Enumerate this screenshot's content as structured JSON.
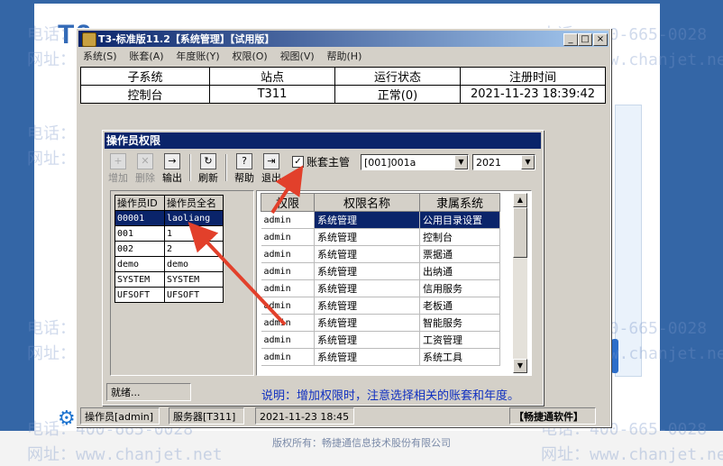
{
  "background": {
    "watermark_phone": "电话：400-665-0028",
    "watermark_site": "网址：www.chanjet.net",
    "footer": "版权所有：畅捷通信息技术股份有限公司",
    "logo_fragment": "T3 ",
    "left_tab_label": "账"
  },
  "window": {
    "title": "T3-标准版11.2【系统管理】【试用版】",
    "menu": [
      "系统(S)",
      "账套(A)",
      "年度账(Y)",
      "权限(O)",
      "视图(V)",
      "帮助(H)"
    ],
    "grid_headers": [
      "子系统",
      "站点",
      "运行状态",
      "注册时间"
    ],
    "grid_row": [
      "控制台",
      "T311",
      "正常(0)",
      "2021-11-23 18:39:42"
    ],
    "status": {
      "operator": "操作员[admin]",
      "server": "服务器[T311]",
      "datetime": "2021-11-23 18:45",
      "brand": "【畅捷通软件】"
    }
  },
  "dialog": {
    "title": "操作员权限",
    "toolbar": [
      {
        "label": "增加",
        "icon": "add-icon",
        "enabled": false
      },
      {
        "label": "删除",
        "icon": "delete-icon",
        "enabled": false
      },
      {
        "label": "输出",
        "icon": "export-icon",
        "enabled": true
      },
      {
        "label": "刷新",
        "icon": "refresh-icon",
        "enabled": true
      },
      {
        "label": "帮助",
        "icon": "help-icon",
        "enabled": true
      },
      {
        "label": "退出",
        "icon": "exit-icon",
        "enabled": true
      }
    ],
    "account_manager_label": "账套主管",
    "account_manager_checked": true,
    "account_select": "[001]001a",
    "year_select": "2021",
    "operator_headers": [
      "操作员ID",
      "操作员全名"
    ],
    "operators": [
      {
        "id": "00001",
        "name": "laoliang",
        "selected": true
      },
      {
        "id": "001",
        "name": "1",
        "selected": false
      },
      {
        "id": "002",
        "name": "2",
        "selected": false
      },
      {
        "id": "demo",
        "name": "demo",
        "selected": false
      },
      {
        "id": "SYSTEM",
        "name": "SYSTEM",
        "selected": false
      },
      {
        "id": "UFSOFT",
        "name": "UFSOFT",
        "selected": false
      }
    ],
    "permission_headers": [
      "权限",
      "权限名称",
      "隶属系统"
    ],
    "permissions": [
      {
        "perm": "admin",
        "name": "系统管理",
        "system": "公用目录设置"
      },
      {
        "perm": "admin",
        "name": "系统管理",
        "system": "控制台"
      },
      {
        "perm": "admin",
        "name": "系统管理",
        "system": "票据通"
      },
      {
        "perm": "admin",
        "name": "系统管理",
        "system": "出纳通"
      },
      {
        "perm": "admin",
        "name": "系统管理",
        "system": "信用服务"
      },
      {
        "perm": "admin",
        "name": "系统管理",
        "system": "老板通"
      },
      {
        "perm": "admin",
        "name": "系统管理",
        "system": "智能服务"
      },
      {
        "perm": "admin",
        "name": "系统管理",
        "system": "工资管理"
      },
      {
        "perm": "admin",
        "name": "系统管理",
        "system": "系统工具"
      }
    ],
    "status": "就绪...",
    "note": "说明：增加权限时，注意选择相关的账套和年度。"
  },
  "colors": {
    "title_bar": "#0a246a",
    "selection": "#0a246a",
    "note_text": "#1030c0",
    "arrow": "#e2402b",
    "desktop_blue": "#3466a6"
  }
}
